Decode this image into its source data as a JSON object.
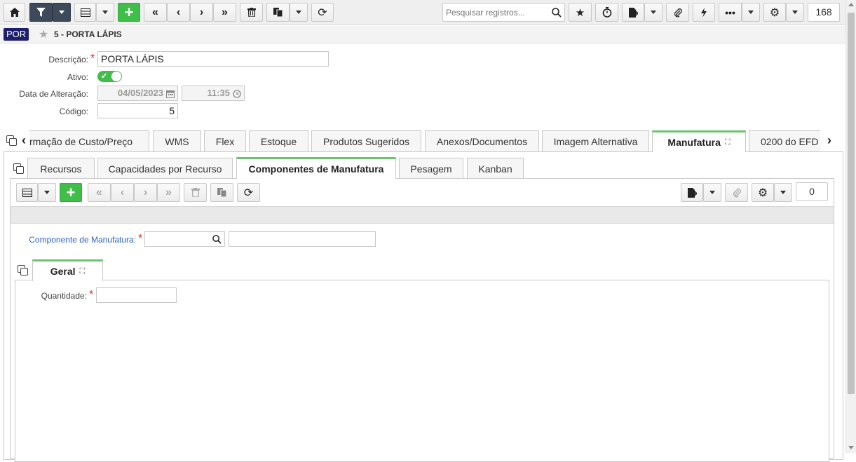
{
  "toolbar": {
    "search_placeholder": "Pesquisar registros...",
    "record_count": "168"
  },
  "header": {
    "lang": "POR",
    "title": "5 - PORTA LÁPIS"
  },
  "form": {
    "descricao_label": "Descrição:",
    "descricao_value": "PORTA LÁPIS",
    "ativo_label": "Ativo:",
    "data_label": "Data de Alteração:",
    "data_value": "04/05/2023",
    "hora_value": "11:35",
    "codigo_label": "Código:",
    "codigo_value": "5"
  },
  "main_tabs": [
    "rmação de Custo/Preço",
    "WMS",
    "Flex",
    "Estoque",
    "Produtos Sugeridos",
    "Anexos/Documentos",
    "Imagem Alternativa",
    "Manufatura",
    "0200 do EFD"
  ],
  "sub_tabs": [
    "Recursos",
    "Capacidades por Recurso",
    "Componentes de Manufatura",
    "Pesagem",
    "Kanban"
  ],
  "sub_toolbar": {
    "record_count": "0"
  },
  "component": {
    "label": "Componente de Manufatura:",
    "value": "",
    "description_value": ""
  },
  "inner_tabs": [
    "Geral"
  ],
  "geral": {
    "quantidade_label": "Quantidade:",
    "quantidade_value": ""
  },
  "colors": {
    "accent_green": "#3fbf4a",
    "active_tab_border": "#6cc46f",
    "dark_button": "#3d4a5c",
    "link_blue": "#2b62c0"
  }
}
